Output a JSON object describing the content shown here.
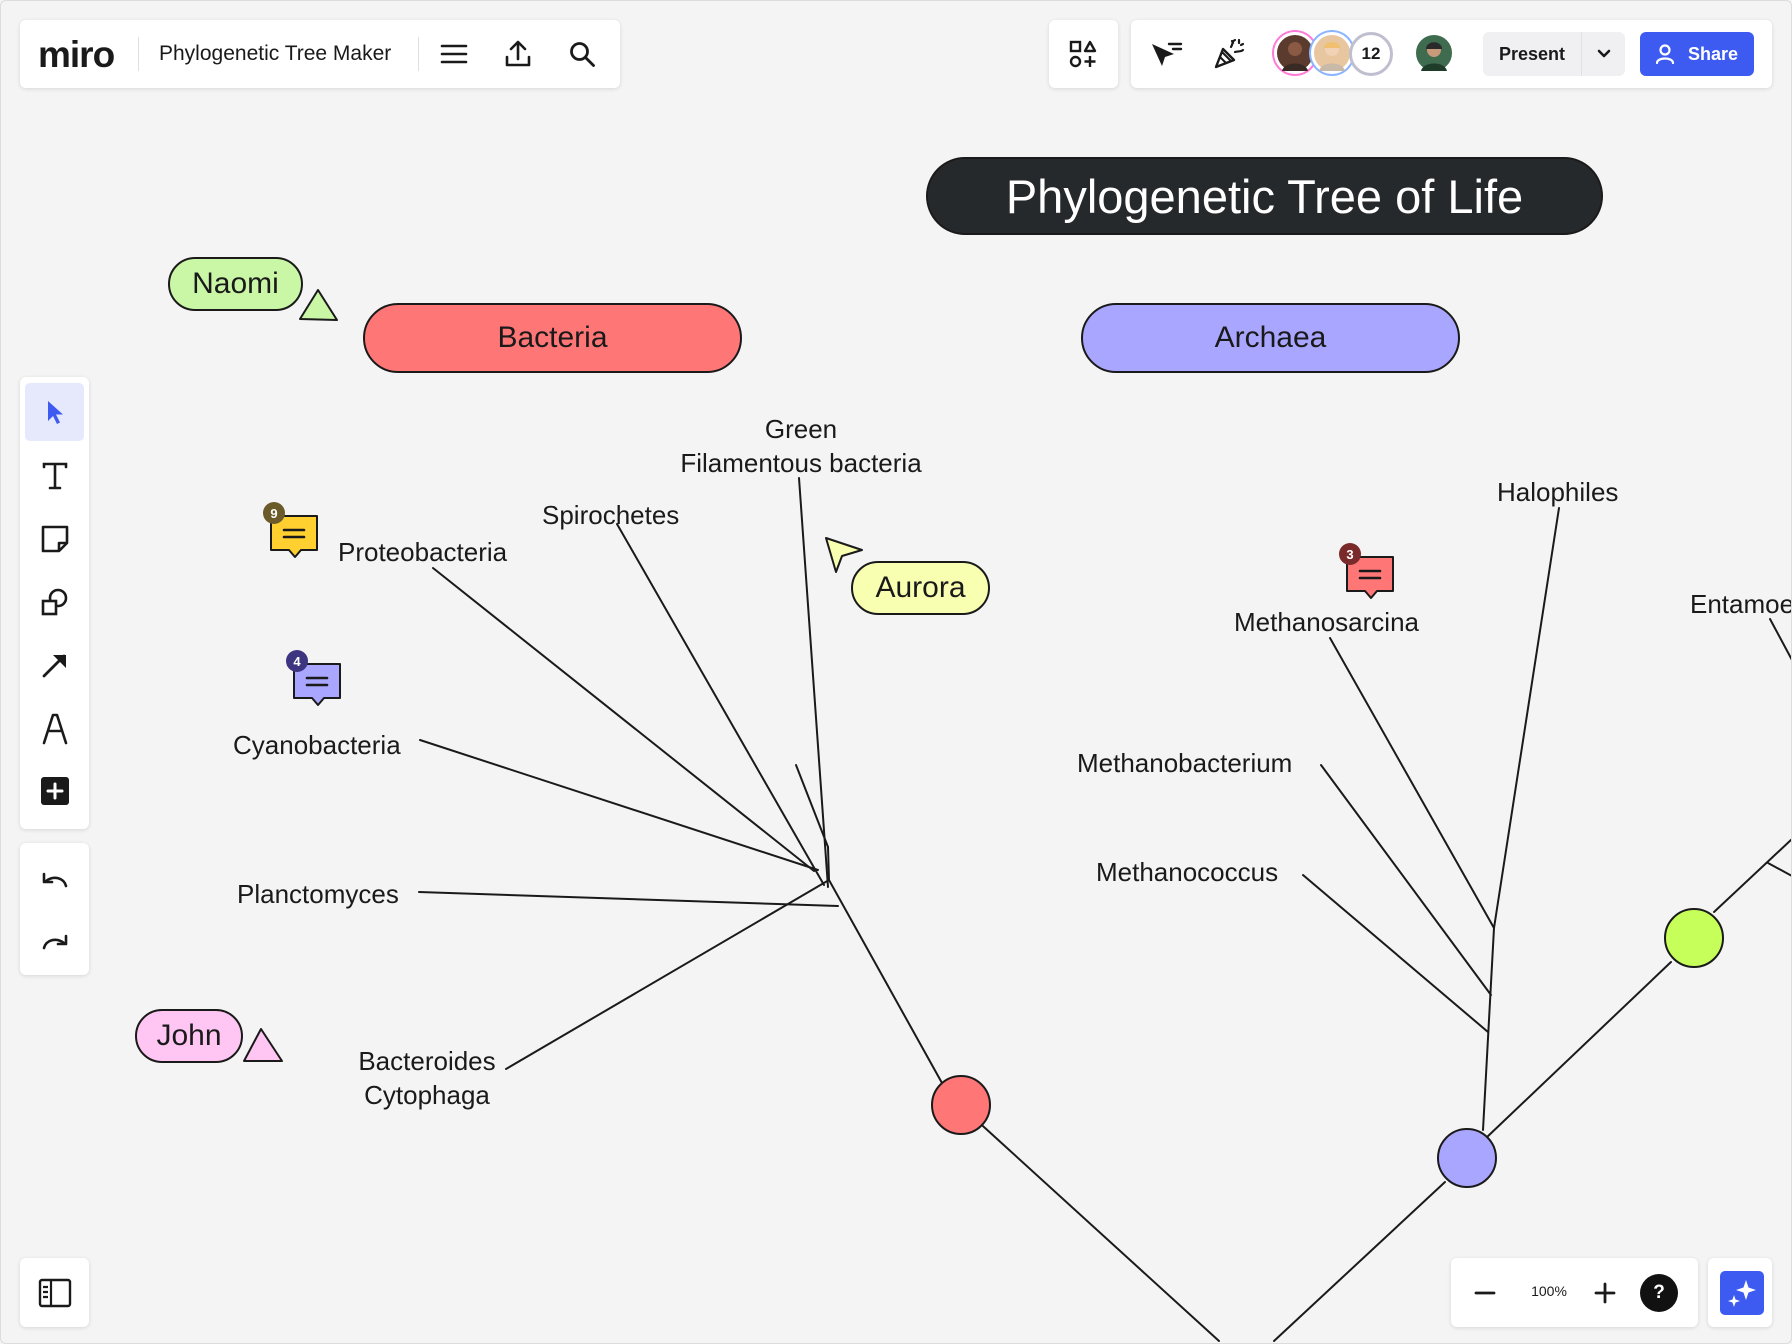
{
  "app": {
    "logo": "miro",
    "board_title": "Phylogenetic Tree Maker"
  },
  "toolbar_right": {
    "collaborator_count": "12",
    "present_label": "Present",
    "share_label": "Share"
  },
  "canvas": {
    "title": "Phylogenetic Tree of Life",
    "groups": {
      "bacteria": "Bacteria",
      "archaea": "Archaea"
    },
    "bacteria_taxa": {
      "proteobacteria": "Proteobacteria",
      "spirochetes": "Spirochetes",
      "green_line1": "Green",
      "green_line2": "Filamentous bacteria",
      "cyanobacteria": "Cyanobacteria",
      "planctomyces": "Planctomyces",
      "bacteroides_line1": "Bacteroides",
      "bacteroides_line2": "Cytophaga"
    },
    "archaea_taxa": {
      "halophiles": "Halophiles",
      "methanosarcina": "Methanosarcina",
      "methanobacterium": "Methanobacterium",
      "methanococcus": "Methanococcus"
    },
    "eukarya_taxa": {
      "entamoeba_partial": "Entamoe"
    },
    "cursors": {
      "naomi": "Naomi",
      "aurora": "Aurora",
      "john": "John"
    },
    "comments": {
      "yellow_count": "9",
      "purple_count": "4",
      "red_count": "3"
    }
  },
  "zoom": {
    "level": "100%",
    "help": "?"
  },
  "colors": {
    "bacteria": "#ff7676",
    "archaea": "#a9a6ff",
    "eukarya": "#c6ff5a",
    "accent": "#3d5bf0",
    "naomi": "#c9f7a6",
    "aurora": "#f8ffb0",
    "john": "#ffc6f4"
  }
}
